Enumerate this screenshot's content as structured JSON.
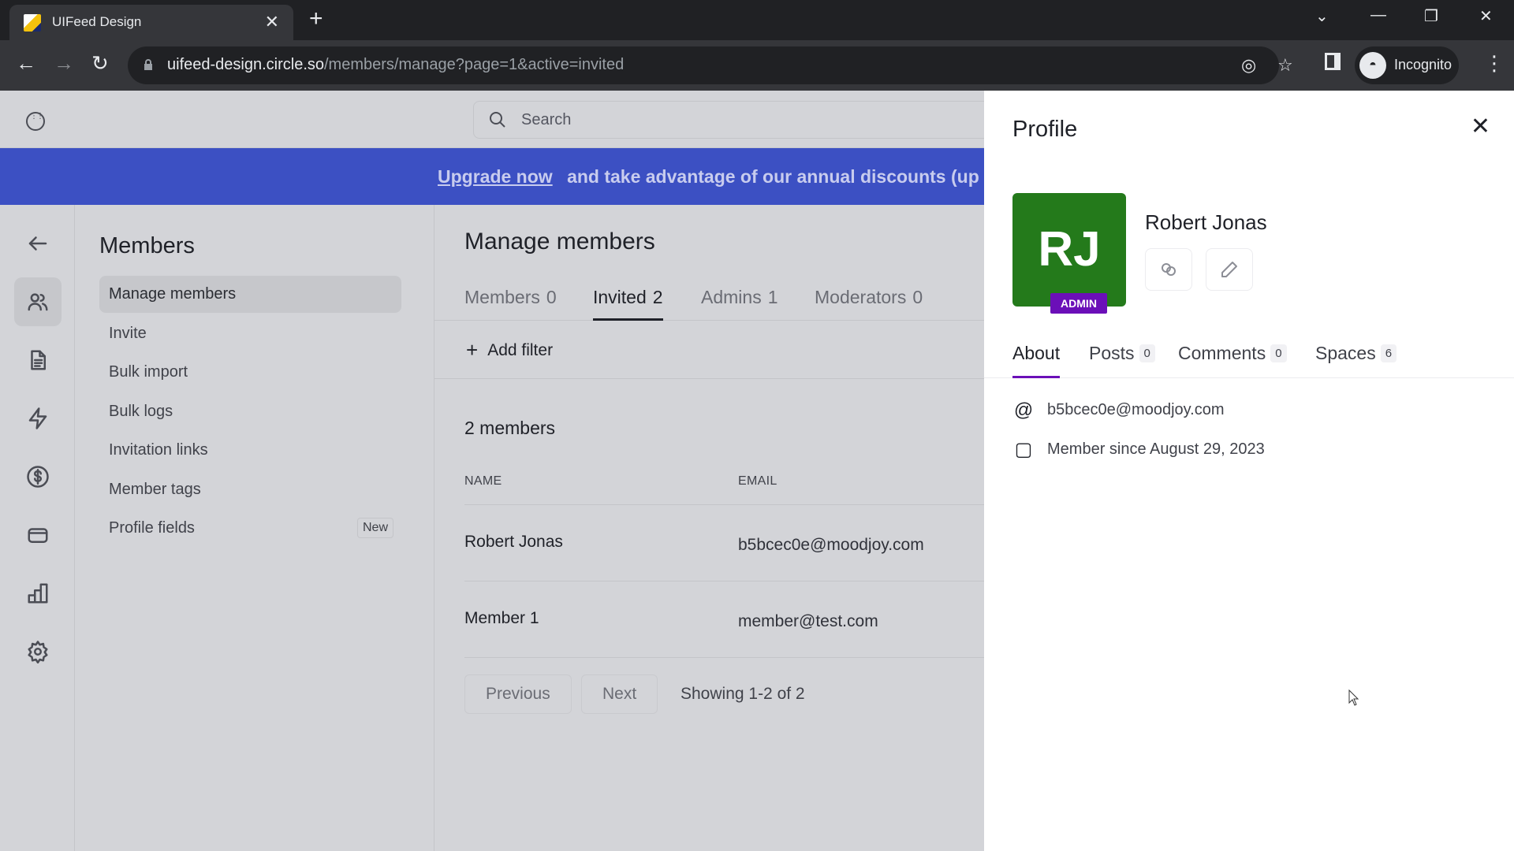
{
  "browser": {
    "tab_title": "UIFeed Design",
    "new_tab_symbol": "+",
    "url_host": "uifeed-design.circle.so",
    "url_path": "/members/manage?page=1&active=invited",
    "profile_label": "Incognito",
    "window_controls": {
      "tab_search": "⌄",
      "minimize": "—",
      "restore": "❐",
      "close": "✕"
    }
  },
  "header": {
    "search_placeholder": "Search"
  },
  "banner": {
    "link_text": "Upgrade now",
    "text": "and take advantage of our annual discounts (up t",
    "color": "#3c50c3"
  },
  "rail": {
    "items": [
      {
        "icon": "arrow-left-icon"
      },
      {
        "icon": "users-icon",
        "active": true
      },
      {
        "icon": "document-icon"
      },
      {
        "icon": "lightning-icon"
      },
      {
        "icon": "dollar-icon"
      },
      {
        "icon": "credit-card-icon"
      },
      {
        "icon": "bar-chart-icon"
      },
      {
        "icon": "gear-icon"
      }
    ]
  },
  "sidebar": {
    "title": "Members",
    "items": [
      {
        "label": "Manage members",
        "active": true
      },
      {
        "label": "Invite"
      },
      {
        "label": "Bulk import"
      },
      {
        "label": "Bulk logs"
      },
      {
        "label": "Invitation links"
      },
      {
        "label": "Member tags"
      },
      {
        "label": "Profile fields",
        "badge": "New"
      }
    ]
  },
  "main": {
    "title": "Manage members",
    "tabs": [
      {
        "label": "Members",
        "count": "0"
      },
      {
        "label": "Invited",
        "count": "2",
        "active": true
      },
      {
        "label": "Admins",
        "count": "1"
      },
      {
        "label": "Moderators",
        "count": "0"
      }
    ],
    "add_filter_label": "Add filter",
    "member_count_label": "2 members",
    "columns": [
      "NAME",
      "EMAIL"
    ],
    "rows": [
      {
        "name": "Robert Jonas",
        "email": "b5bcec0e@moodjoy.com"
      },
      {
        "name": "Member 1",
        "email": "member@test.com"
      }
    ],
    "pagination": {
      "previous_label": "Previous",
      "next_label": "Next",
      "showing_label": "Showing 1-2 of 2"
    }
  },
  "profile": {
    "title": "Profile",
    "initials": "RJ",
    "avatar_color": "#247a1b",
    "role_badge": "ADMIN",
    "role_color": "#6b0fb8",
    "name": "Robert Jonas",
    "tabs": [
      {
        "label": "About",
        "active": true
      },
      {
        "label": "Posts",
        "count": "0"
      },
      {
        "label": "Comments",
        "count": "0"
      },
      {
        "label": "Spaces",
        "count": "6"
      }
    ],
    "email": "b5bcec0e@moodjoy.com",
    "member_since": "Member since August 29, 2023"
  }
}
